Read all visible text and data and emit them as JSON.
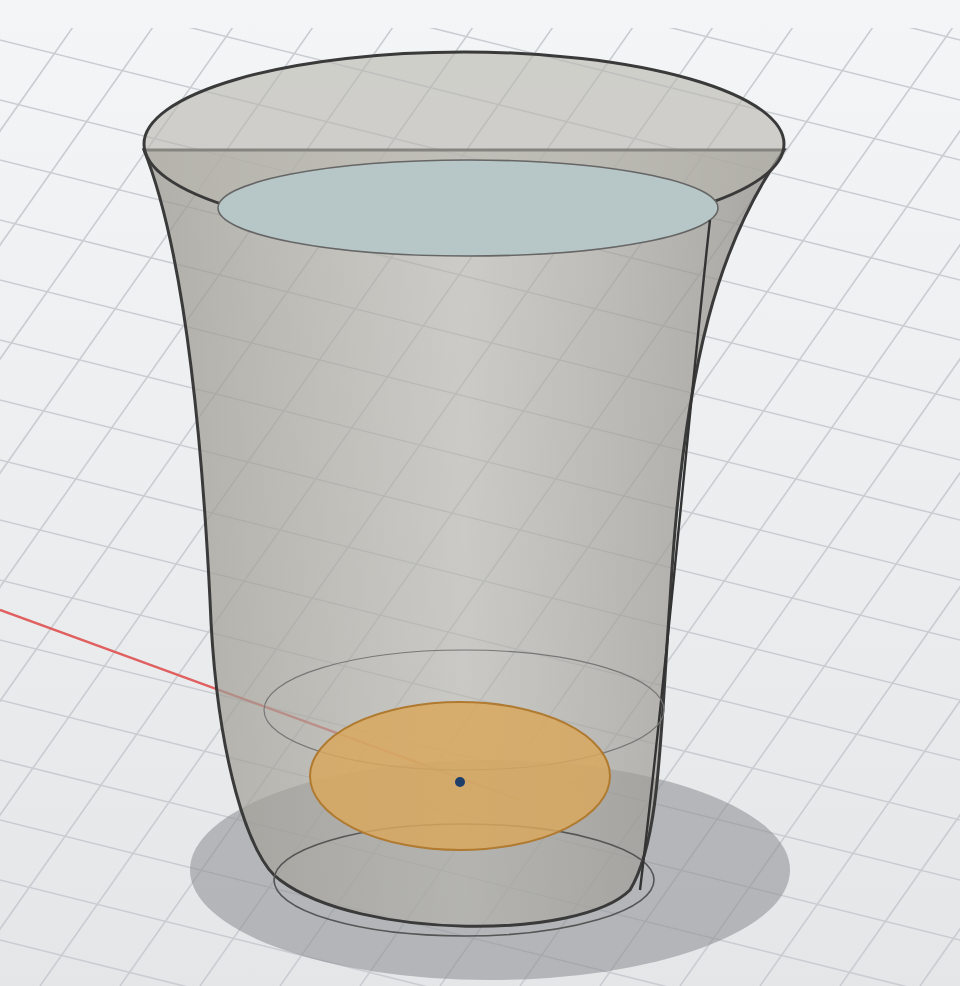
{
  "viewport": {
    "grid": true,
    "x_axis": true,
    "shadow": true
  },
  "model": {
    "bottom_face_selected": true
  }
}
